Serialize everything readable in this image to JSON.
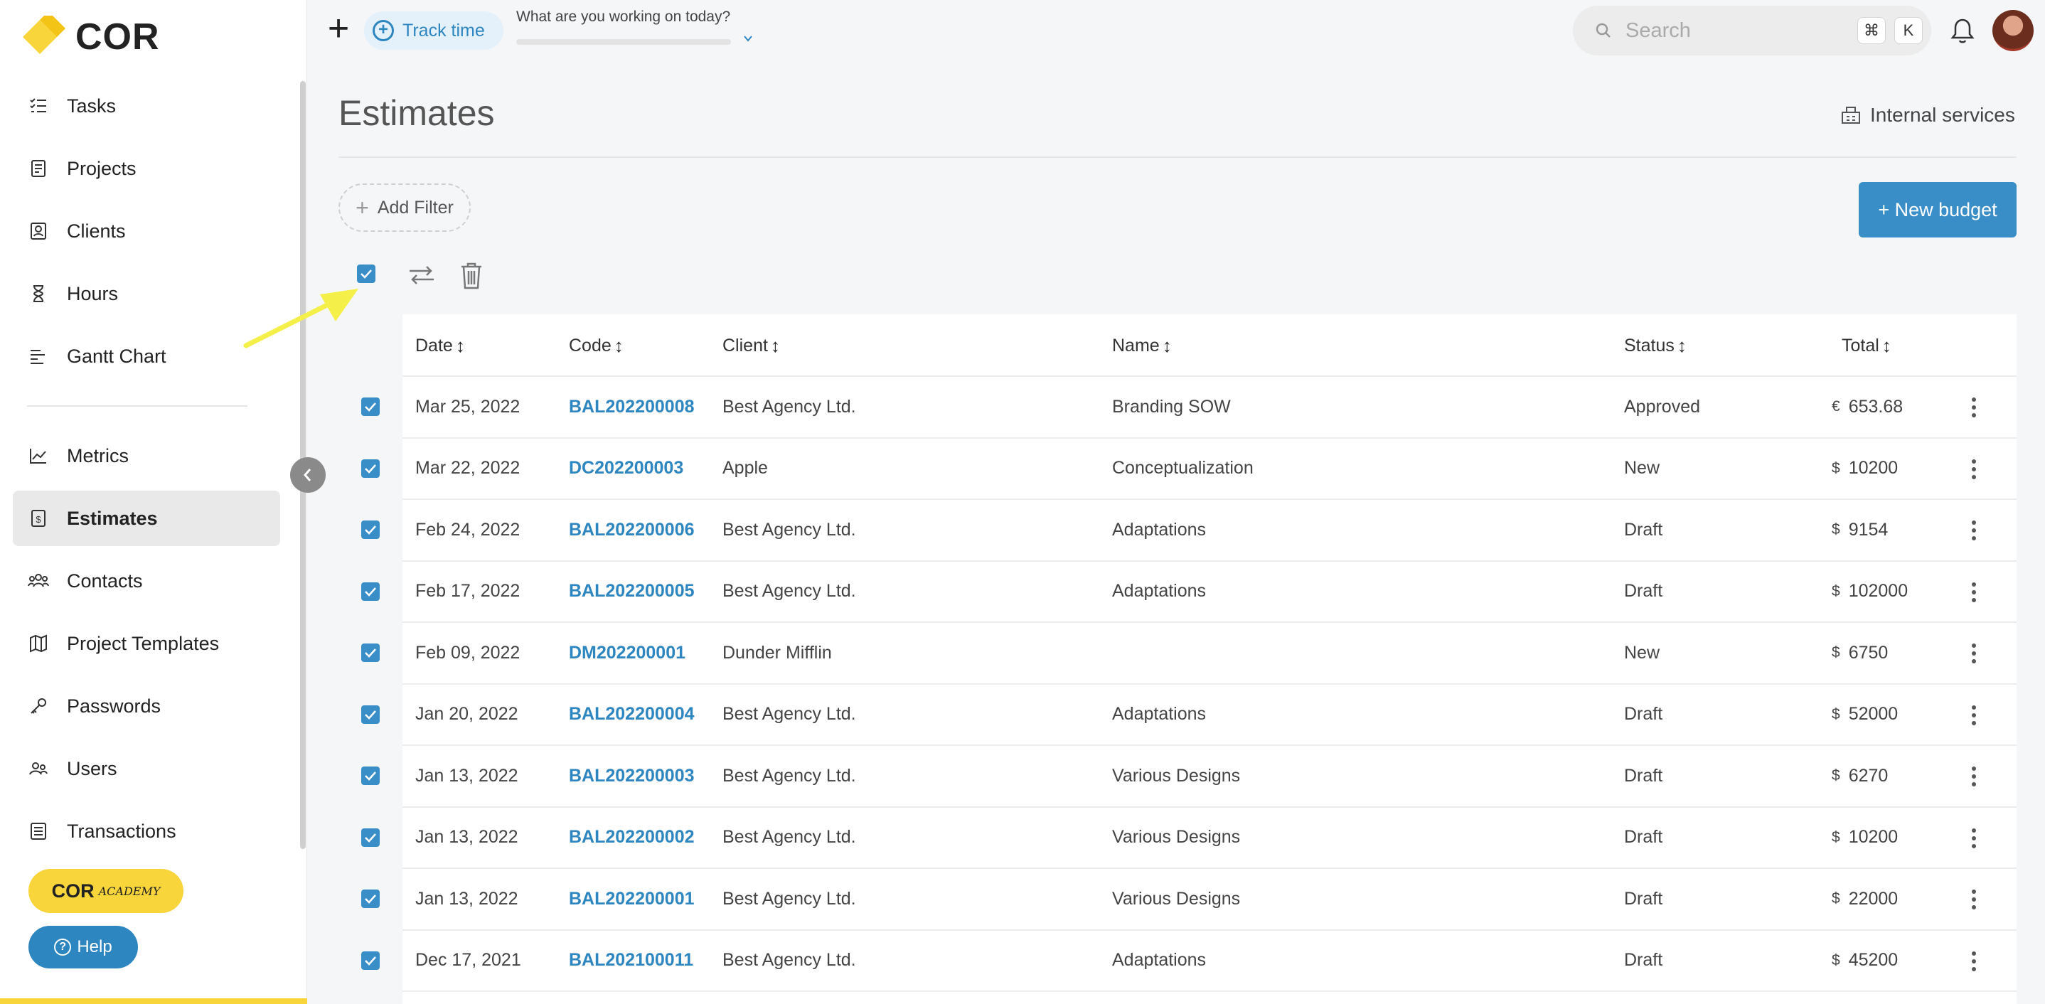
{
  "app": {
    "logo_text": "COR",
    "brand_color": "#f7d53b",
    "accent": "#2e86c1"
  },
  "sidebar": {
    "items": [
      {
        "label": "Tasks",
        "icon": "tasks-icon"
      },
      {
        "label": "Projects",
        "icon": "projects-icon"
      },
      {
        "label": "Clients",
        "icon": "clients-icon"
      },
      {
        "label": "Hours",
        "icon": "hourglass-icon"
      },
      {
        "label": "Gantt Chart",
        "icon": "gantt-icon"
      },
      {
        "label": "Metrics",
        "icon": "metrics-icon"
      },
      {
        "label": "Estimates",
        "icon": "estimates-icon",
        "active": true
      },
      {
        "label": "Contacts",
        "icon": "contacts-icon"
      },
      {
        "label": "Project Templates",
        "icon": "map-icon"
      },
      {
        "label": "Passwords",
        "icon": "key-icon"
      },
      {
        "label": "Users",
        "icon": "users-icon"
      },
      {
        "label": "Transactions",
        "icon": "transactions-icon"
      }
    ],
    "academy_label": "COR",
    "academy_sub": "ACADEMY",
    "help_label": "Help"
  },
  "topbar": {
    "track_label": "Track time",
    "working_prompt": "What are you working on today?",
    "search_placeholder": "Search",
    "kbd_cmd": "⌘",
    "kbd_k": "K"
  },
  "page": {
    "title": "Estimates",
    "internal_services": "Internal services",
    "add_filter": "Add Filter",
    "new_budget": "+ New budget"
  },
  "table": {
    "headers": {
      "date": "Date",
      "code": "Code",
      "client": "Client",
      "name": "Name",
      "status": "Status",
      "total": "Total"
    },
    "rows": [
      {
        "date": "Mar 25, 2022",
        "code": "BAL202200008",
        "client": "Best Agency Ltd.",
        "name": "Branding SOW",
        "status": "Approved",
        "currency": "€",
        "total": "653.68"
      },
      {
        "date": "Mar 22, 2022",
        "code": "DC202200003",
        "client": "Apple",
        "name": "Conceptualization",
        "status": "New",
        "currency": "$",
        "total": "10200"
      },
      {
        "date": "Feb 24, 2022",
        "code": "BAL202200006",
        "client": "Best Agency Ltd.",
        "name": "Adaptations",
        "status": "Draft",
        "currency": "$",
        "total": "9154"
      },
      {
        "date": "Feb 17, 2022",
        "code": "BAL202200005",
        "client": "Best Agency Ltd.",
        "name": "Adaptations",
        "status": "Draft",
        "currency": "$",
        "total": "102000"
      },
      {
        "date": "Feb 09, 2022",
        "code": "DM202200001",
        "client": "Dunder Mifflin",
        "name": "",
        "status": "New",
        "currency": "$",
        "total": "6750"
      },
      {
        "date": "Jan 20, 2022",
        "code": "BAL202200004",
        "client": "Best Agency Ltd.",
        "name": "Adaptations",
        "status": "Draft",
        "currency": "$",
        "total": "52000"
      },
      {
        "date": "Jan 13, 2022",
        "code": "BAL202200003",
        "client": "Best Agency Ltd.",
        "name": "Various Designs",
        "status": "Draft",
        "currency": "$",
        "total": "6270"
      },
      {
        "date": "Jan 13, 2022",
        "code": "BAL202200002",
        "client": "Best Agency Ltd.",
        "name": "Various Designs",
        "status": "Draft",
        "currency": "$",
        "total": "10200"
      },
      {
        "date": "Jan 13, 2022",
        "code": "BAL202200001",
        "client": "Best Agency Ltd.",
        "name": "Various Designs",
        "status": "Draft",
        "currency": "$",
        "total": "22000"
      },
      {
        "date": "Dec 17, 2021",
        "code": "BAL202100011",
        "client": "Best Agency Ltd.",
        "name": "Adaptations",
        "status": "Draft",
        "currency": "$",
        "total": "45200"
      }
    ]
  }
}
